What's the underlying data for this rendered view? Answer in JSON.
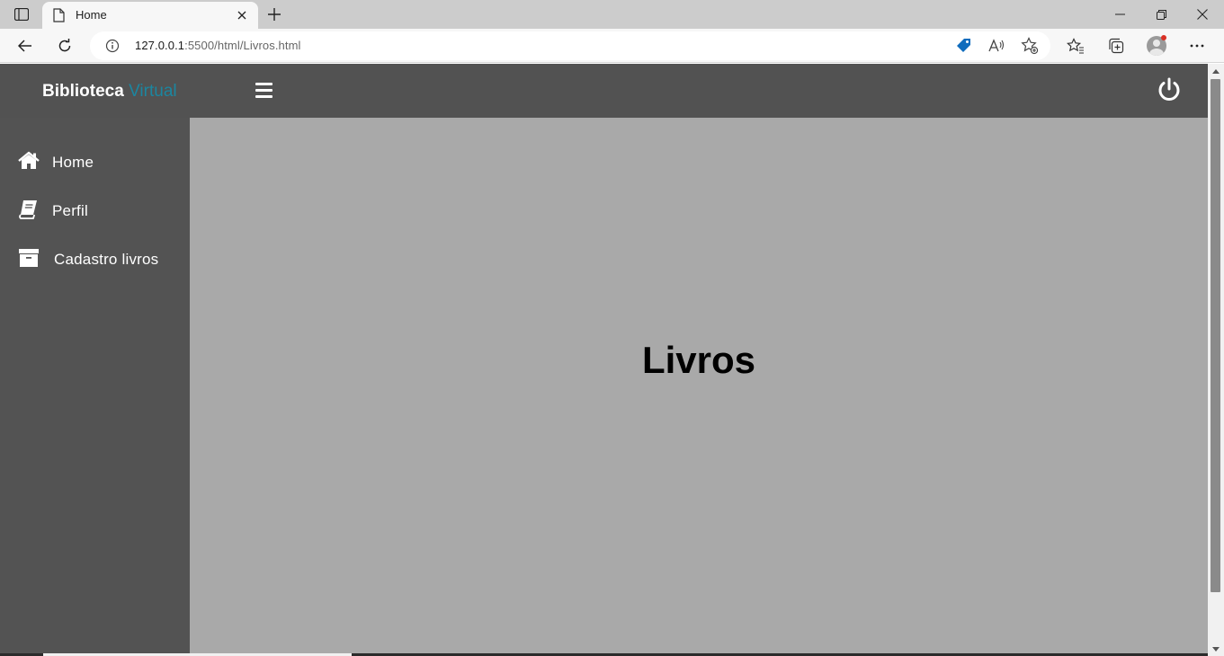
{
  "browser": {
    "tab": {
      "title": "Home"
    },
    "address": {
      "host": "127.0.0.1",
      "rest": ":5500/html/Livros.html"
    }
  },
  "header": {
    "brand_main": "Biblioteca",
    "brand_accent": "Virtual"
  },
  "sidebar": {
    "items": [
      {
        "label": "Home",
        "icon": "home-icon"
      },
      {
        "label": "Perfil",
        "icon": "book-icon"
      },
      {
        "label": "Cadastro livros",
        "icon": "archive-box-icon"
      }
    ]
  },
  "main": {
    "heading": "Livros"
  },
  "colors": {
    "header_bg": "#525252",
    "sidebar_bg": "#535353",
    "content_bg": "#a9a9a9",
    "brand_accent": "#1b86a0"
  }
}
